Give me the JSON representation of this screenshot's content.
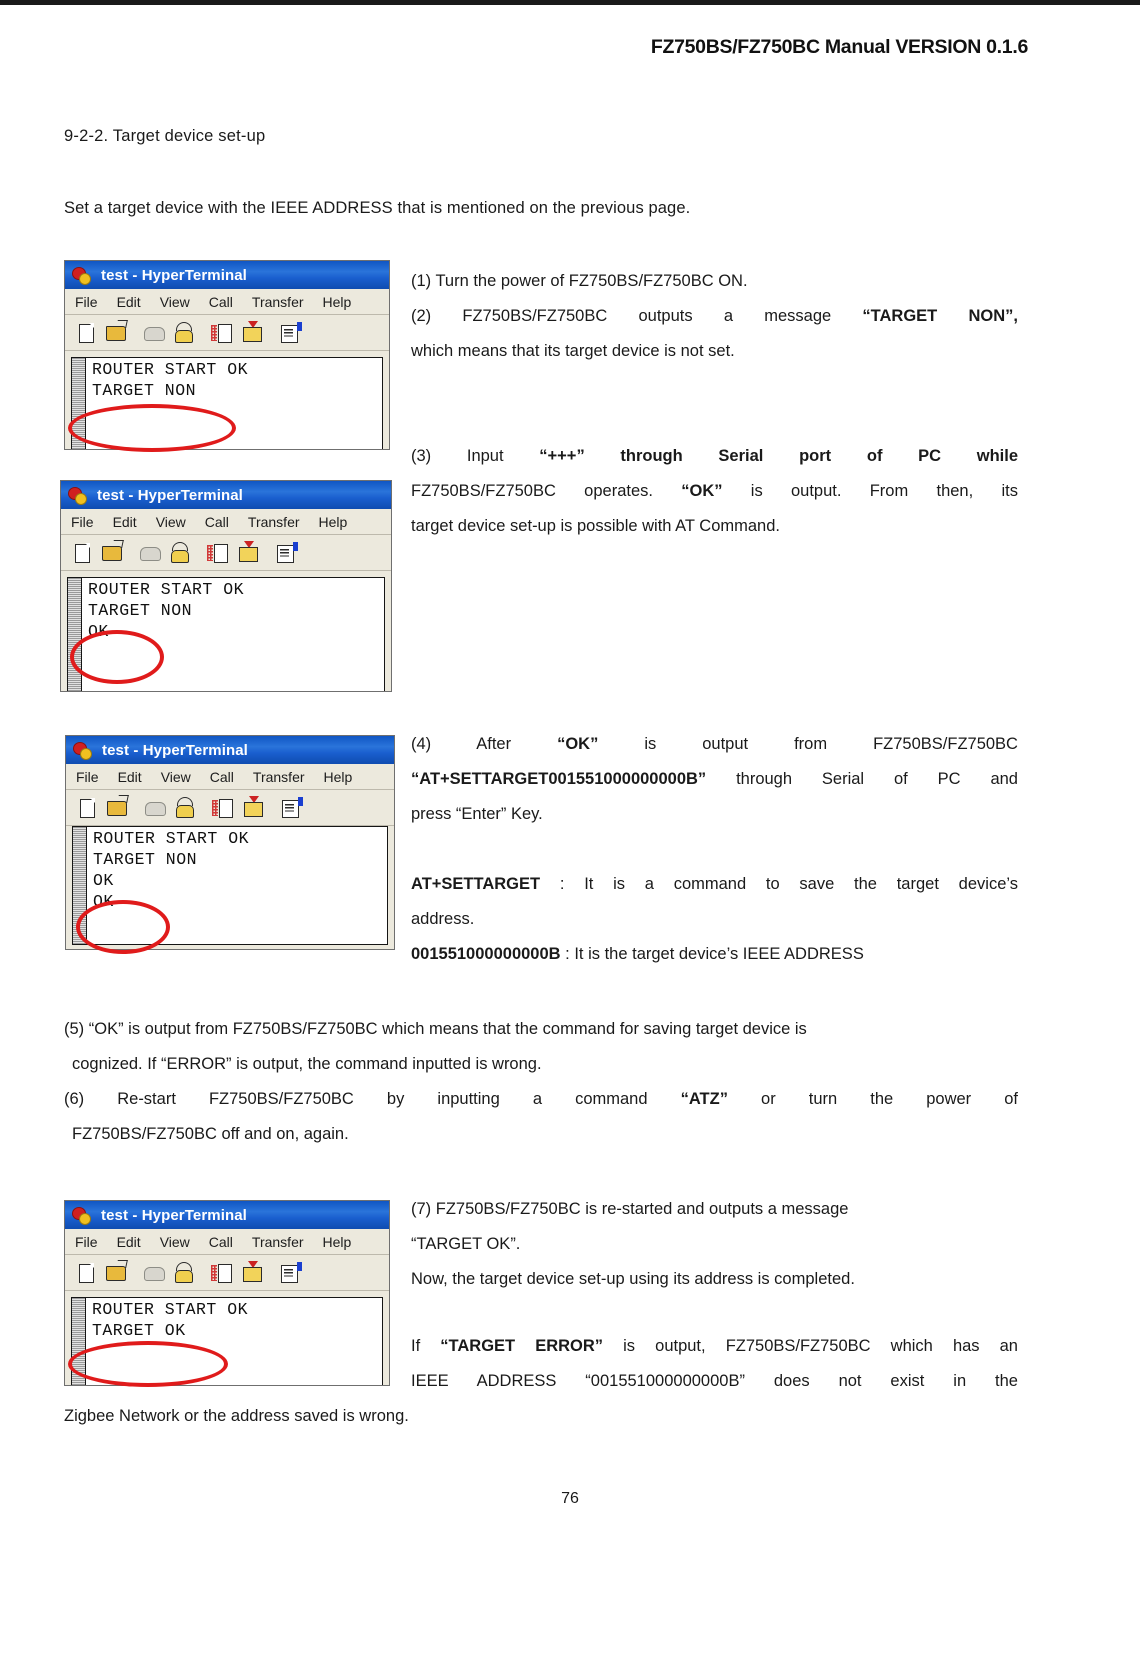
{
  "header": {
    "title": "FZ750BS/FZ750BC Manual VERSION 0.1.6"
  },
  "section": {
    "title": "9-2-2. Target device set-up",
    "intro": "Set a target device with the IEEE ADDRESS that is mentioned on the previous page."
  },
  "terminal_chrome": {
    "window_title": "test - HyperTerminal",
    "menus": [
      "File",
      "Edit",
      "View",
      "Call",
      "Transfer",
      "Help"
    ],
    "toolbar_icons": [
      "new-connection-icon",
      "open-folder-icon",
      "disconnect-phone-icon",
      "connect-phone-icon",
      "receive-file-icon",
      "send-file-icon",
      "properties-icon"
    ]
  },
  "terminals": [
    {
      "id": "terminal-1",
      "lines": [
        "ROUTER START OK",
        "TARGET NON"
      ],
      "highlight_line": "TARGET NON"
    },
    {
      "id": "terminal-2",
      "lines": [
        "ROUTER START OK",
        "TARGET NON",
        "OK"
      ],
      "highlight_line": "OK"
    },
    {
      "id": "terminal-3",
      "lines": [
        "ROUTER START OK",
        "TARGET NON",
        "OK",
        "OK"
      ],
      "highlight_line": "OK"
    },
    {
      "id": "terminal-4",
      "lines": [
        "ROUTER START OK",
        "TARGET OK"
      ],
      "highlight_line": "TARGET OK"
    }
  ],
  "steps": {
    "s1": "(1) Turn the power of FZ750BS/FZ750BC ON.",
    "s2_a": "(2)  FZ750BS/FZ750BC  outputs  a  message",
    "s2_b": "“TARGET  NON”,",
    "s2_c": "which means that its target device is not set.",
    "s3_a": "(3)",
    "s3_b": "Input",
    "s3_c": "“+++”",
    "s3_d": "through",
    "s3_e": "Serial",
    "s3_f": "port",
    "s3_g": "of",
    "s3_h": "PC",
    "s3_i": "while",
    "s3_j": "FZ750BS/FZ750BC  operates.",
    "s3_k": "“OK”",
    "s3_l": "is  output.  From  then,  its",
    "s3_m": "target device set-up is possible with AT Command.",
    "s4_a": "(4)",
    "s4_b": "After",
    "s4_c": "“OK”",
    "s4_d": "is",
    "s4_e": "output",
    "s4_f": "from",
    "s4_g": "FZ750BS/FZ750BC",
    "s4_h": "“AT+SETTARGET001551000000000B”",
    "s4_i": "through  Serial  of  PC  and",
    "s4_j": "press “Enter” Key.",
    "def1_term": "AT+SETTARGET",
    "def1_text": " : It  is  a  command  to  save  the  target  device’s",
    "def1_text2": "address.",
    "def2_term": "001551000000000B",
    "def2_text": " : It is the target device’s IEEE ADDRESS",
    "s5_a": "(5) “OK” is output from FZ750BS/FZ750BC which means that the command for saving target device is",
    "s5_b": "cognized. If “ERROR” is output, the command inputted is wrong.",
    "s6_a": "(6)   Re-start   FZ750BS/FZ750BC   by   inputting   a   command",
    "s6_b": "“ATZ”",
    "s6_c": "or   turn   the   power   of",
    "s6_d": "FZ750BS/FZ750BC off and on, again.",
    "s7_a": "(7)  FZ750BS/FZ750BC  is  re-started  and  outputs  a  message",
    "s7_b": "“TARGET OK”.",
    "s7_c": "Now, the target device set-up using its address is completed.",
    "s8_a": "If",
    "s8_b": "“TARGET ERROR”",
    "s8_c": "is  output,  FZ750BS/FZ750BC  which  has  an",
    "s8_d": "IEEE  ADDRESS  “001551000000000B”  does  not  exist  in  the",
    "s8_e": "Zigbee Network or the address saved is wrong."
  },
  "footer": {
    "page_number": "76"
  },
  "colors": {
    "annotation_red": "#e01b1b",
    "titlebar_blue": "#1a5fcf",
    "chrome_beige": "#ece9dd"
  }
}
